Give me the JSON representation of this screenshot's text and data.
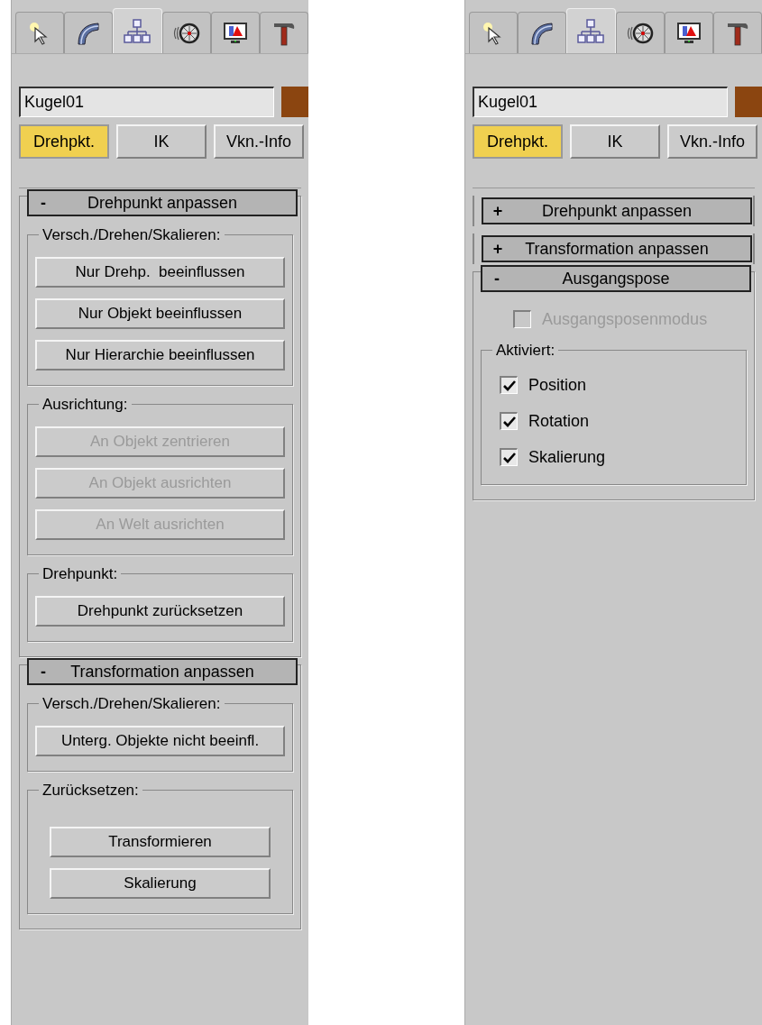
{
  "panels": [
    {
      "tabs": [
        {
          "kind": "create",
          "selected": false
        },
        {
          "kind": "modify",
          "selected": false
        },
        {
          "kind": "hierarchy",
          "selected": true
        },
        {
          "kind": "motion",
          "selected": false
        },
        {
          "kind": "display",
          "selected": false
        },
        {
          "kind": "utilities",
          "selected": false
        }
      ],
      "name_field": {
        "value": "Kugel01"
      },
      "object_color": {
        "color": "#8b4510"
      },
      "modes": [
        {
          "label": "Drehpkt.",
          "selected": true
        },
        {
          "label": "IK",
          "selected": false
        },
        {
          "label": "Vkn.-Info",
          "selected": false
        }
      ],
      "rollouts": [
        {
          "title": "Drehpunkt anpassen",
          "toggle": "-",
          "expanded": true,
          "content": [
            {
              "kind": "group",
              "title": "Versch./Drehen/Skalieren:",
              "items": [
                {
                  "kind": "button",
                  "label": "Nur Drehp.  beeinflussen",
                  "disabled": false
                },
                {
                  "kind": "button",
                  "label": "Nur Objekt beeinflussen",
                  "disabled": false
                },
                {
                  "kind": "button",
                  "label": "Nur Hierarchie beeinflussen",
                  "disabled": false
                }
              ]
            },
            {
              "kind": "group",
              "title": "Ausrichtung:",
              "items": [
                {
                  "kind": "button",
                  "label": "An Objekt zentrieren",
                  "disabled": true
                },
                {
                  "kind": "button",
                  "label": "An Objekt ausrichten",
                  "disabled": true
                },
                {
                  "kind": "button",
                  "label": "An Welt ausrichten",
                  "disabled": true
                }
              ]
            },
            {
              "kind": "group",
              "title": "Drehpunkt:",
              "items": [
                {
                  "kind": "button",
                  "label": "Drehpunkt zurücksetzen",
                  "disabled": false
                }
              ]
            }
          ]
        },
        {
          "title": "Transformation anpassen",
          "toggle": "-",
          "expanded": true,
          "content": [
            {
              "kind": "group",
              "title": "Versch./Drehen/Skalieren:",
              "items": [
                {
                  "kind": "button",
                  "label": "Unterg. Objekte nicht beeinfl.",
                  "disabled": false
                }
              ]
            },
            {
              "kind": "group",
              "title": "Zurücksetzen:",
              "inset": true,
              "items": [
                {
                  "kind": "button",
                  "label": "Transformieren",
                  "disabled": false
                },
                {
                  "kind": "button",
                  "label": "Skalierung",
                  "disabled": false
                }
              ]
            }
          ]
        }
      ]
    },
    {
      "tabs": [
        {
          "kind": "create",
          "selected": false
        },
        {
          "kind": "modify",
          "selected": false
        },
        {
          "kind": "hierarchy",
          "selected": true
        },
        {
          "kind": "motion",
          "selected": false
        },
        {
          "kind": "display",
          "selected": false
        },
        {
          "kind": "utilities",
          "selected": false
        }
      ],
      "name_field": {
        "value": "Kugel01"
      },
      "object_color": {
        "color": "#8b4510"
      },
      "modes": [
        {
          "label": "Drehpkt.",
          "selected": true
        },
        {
          "label": "IK",
          "selected": false
        },
        {
          "label": "Vkn.-Info",
          "selected": false
        }
      ],
      "rollouts": [
        {
          "title": "Drehpunkt anpassen",
          "toggle": "+",
          "expanded": false
        },
        {
          "title": "Transformation anpassen",
          "toggle": "+",
          "expanded": false
        },
        {
          "title": "Ausgangspose",
          "toggle": "-",
          "expanded": true,
          "content": [
            {
              "kind": "checkbox",
              "label": "Ausgangsposenmodus",
              "checked": false,
              "disabled": true
            },
            {
              "kind": "group",
              "title": "Aktiviert:",
              "items": [
                {
                  "kind": "checkbox",
                  "label": "Position",
                  "checked": true,
                  "disabled": false
                },
                {
                  "kind": "checkbox",
                  "label": "Rotation",
                  "checked": true,
                  "disabled": false
                },
                {
                  "kind": "checkbox",
                  "label": "Skalierung",
                  "checked": true,
                  "disabled": false
                }
              ]
            }
          ]
        }
      ]
    }
  ]
}
